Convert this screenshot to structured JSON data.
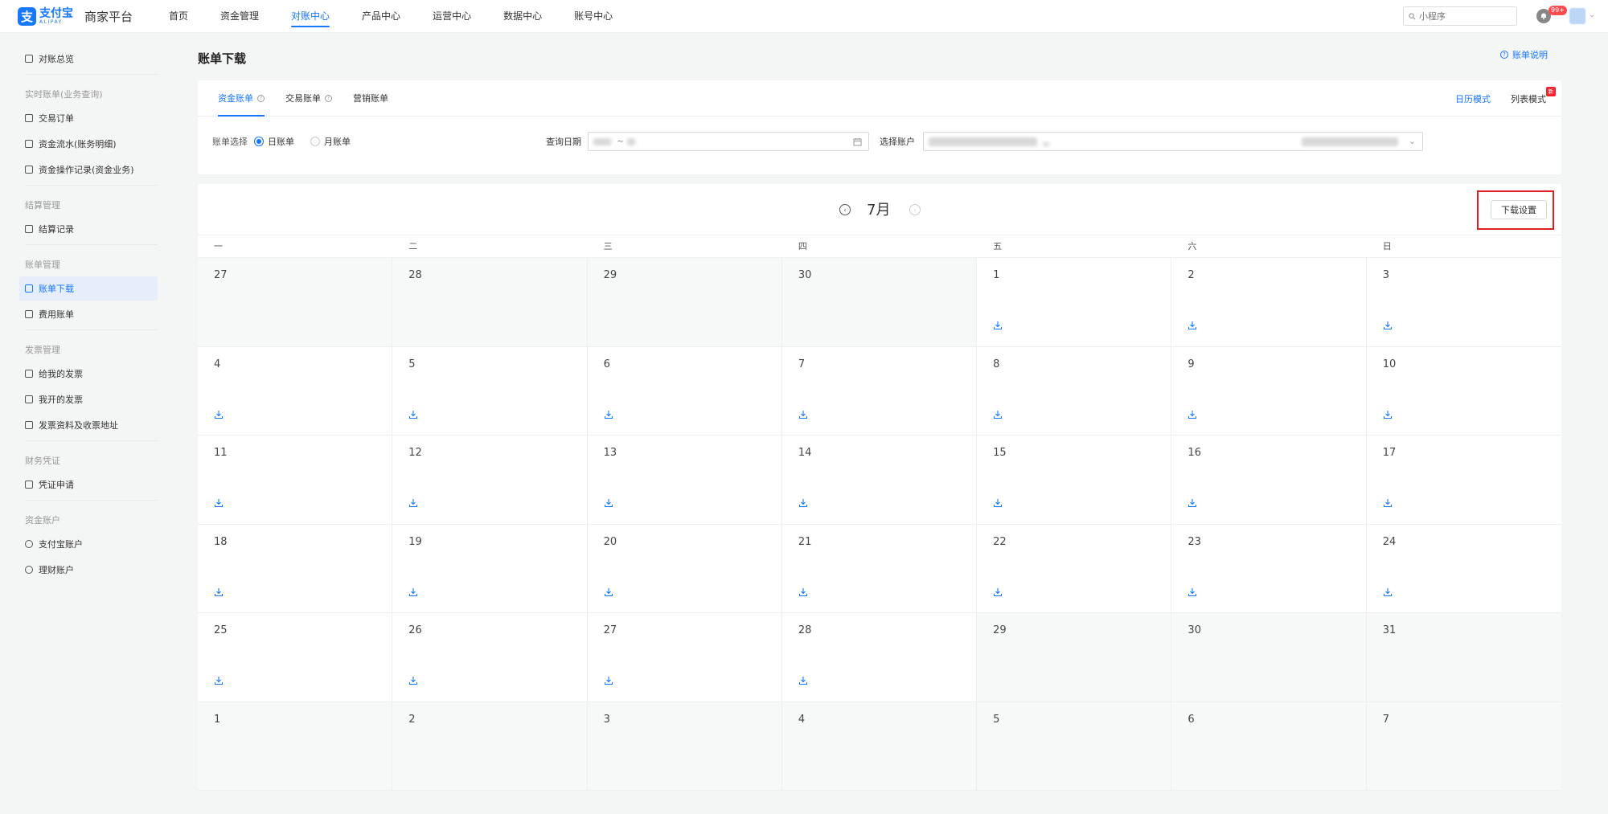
{
  "header": {
    "logo_cn": "支付宝",
    "logo_en": "ALIPAY",
    "platform": "商家平台",
    "nav": [
      "首页",
      "资金管理",
      "对账中心",
      "产品中心",
      "运营中心",
      "数据中心",
      "账号中心"
    ],
    "active_nav": "对账中心",
    "search_placeholder": "小程序",
    "notification_badge": "99+"
  },
  "sidebar": {
    "top_item": "对账总览",
    "groups": [
      {
        "title": "实时账单(业务查询)",
        "items": [
          "交易订单",
          "资金流水(账务明细)",
          "资金操作记录(资金业务)"
        ]
      },
      {
        "title": "结算管理",
        "items": [
          "结算记录"
        ]
      },
      {
        "title": "账单管理",
        "items": [
          "账单下载",
          "费用账单"
        ]
      },
      {
        "title": "发票管理",
        "items": [
          "给我的发票",
          "我开的发票",
          "发票资料及收票地址"
        ]
      },
      {
        "title": "财务凭证",
        "items": [
          "凭证申请"
        ]
      },
      {
        "title": "资金账户",
        "items": [
          "支付宝账户",
          "理财账户"
        ]
      }
    ],
    "active_item": "账单下载"
  },
  "main": {
    "title": "账单下载",
    "help_link": "账单说明",
    "tabs": [
      "资金账单",
      "交易账单",
      "营销账单"
    ],
    "active_tab": "资金账单",
    "mode_calendar": "日历模式",
    "mode_list": "列表模式",
    "mode_list_badge": "新",
    "filter": {
      "bill_select_label": "账单选择",
      "daily": "日账单",
      "monthly": "月账单",
      "query_date_label": "查询日期",
      "date_separator": "~",
      "account_label": "选择账户"
    },
    "calendar": {
      "month": "7月",
      "download_settings": "下载设置",
      "weekdays": [
        "一",
        "二",
        "三",
        "四",
        "五",
        "六",
        "日"
      ],
      "days": [
        {
          "d": "27",
          "dl": false,
          "muted": true
        },
        {
          "d": "28",
          "dl": false,
          "muted": true
        },
        {
          "d": "29",
          "dl": false,
          "muted": true
        },
        {
          "d": "30",
          "dl": false,
          "muted": true
        },
        {
          "d": "1",
          "dl": true
        },
        {
          "d": "2",
          "dl": true
        },
        {
          "d": "3",
          "dl": true
        },
        {
          "d": "4",
          "dl": true
        },
        {
          "d": "5",
          "dl": true
        },
        {
          "d": "6",
          "dl": true
        },
        {
          "d": "7",
          "dl": true
        },
        {
          "d": "8",
          "dl": true
        },
        {
          "d": "9",
          "dl": true
        },
        {
          "d": "10",
          "dl": true
        },
        {
          "d": "11",
          "dl": true
        },
        {
          "d": "12",
          "dl": true
        },
        {
          "d": "13",
          "dl": true
        },
        {
          "d": "14",
          "dl": true
        },
        {
          "d": "15",
          "dl": true
        },
        {
          "d": "16",
          "dl": true
        },
        {
          "d": "17",
          "dl": true
        },
        {
          "d": "18",
          "dl": true
        },
        {
          "d": "19",
          "dl": true
        },
        {
          "d": "20",
          "dl": true
        },
        {
          "d": "21",
          "dl": true
        },
        {
          "d": "22",
          "dl": true
        },
        {
          "d": "23",
          "dl": true
        },
        {
          "d": "24",
          "dl": true
        },
        {
          "d": "25",
          "dl": true
        },
        {
          "d": "26",
          "dl": true
        },
        {
          "d": "27",
          "dl": true
        },
        {
          "d": "28",
          "dl": true
        },
        {
          "d": "29",
          "dl": false,
          "muted": true
        },
        {
          "d": "30",
          "dl": false,
          "muted": true
        },
        {
          "d": "31",
          "dl": false,
          "muted": true
        },
        {
          "d": "1",
          "dl": false,
          "muted": true
        },
        {
          "d": "2",
          "dl": false,
          "muted": true
        },
        {
          "d": "3",
          "dl": false,
          "muted": true
        },
        {
          "d": "4",
          "dl": false,
          "muted": true
        },
        {
          "d": "5",
          "dl": false,
          "muted": true
        },
        {
          "d": "6",
          "dl": false,
          "muted": true
        },
        {
          "d": "7",
          "dl": false,
          "muted": true
        }
      ]
    }
  },
  "colors": {
    "accent": "#1677ff",
    "highlight": "#e02020",
    "badge": "#ff4d4f"
  }
}
